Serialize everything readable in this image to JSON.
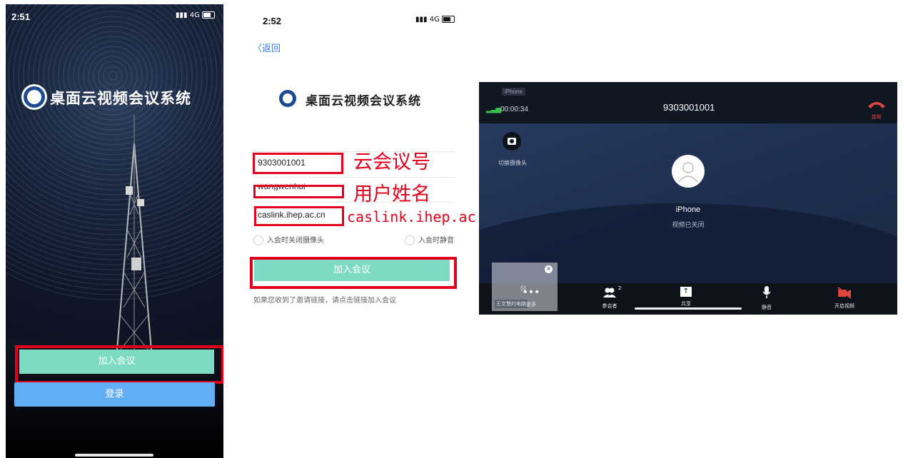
{
  "screen1": {
    "status": {
      "time": "2:51",
      "signal": "4G"
    },
    "app_title": "桌面云视频会议系统",
    "join_button": "加入会议",
    "login_button": "登录"
  },
  "screen2": {
    "status": {
      "time": "2:52",
      "signal": "4G"
    },
    "back": "〈返回",
    "app_title": "桌面云视频会议系统",
    "fields": {
      "meeting_id": "9303001001",
      "user_name": "wangwenhui",
      "server": "caslink.ihep.ac.cn"
    },
    "annotations": {
      "meeting_id": "云会议号",
      "user_name": "用户姓名",
      "server": "caslink.ihep.ac.cn"
    },
    "options": {
      "camera_off": "入会时关闭摄像头",
      "mute": "入会时静音"
    },
    "join_button": "加入会议",
    "hint": "如果您收到了邀请链接，请点击链接加入会议"
  },
  "screen3": {
    "device_label": "iPhone",
    "duration": "00:00:34",
    "meeting_id": "9303001001",
    "hangup": "挂断",
    "switch_camera": "切换摄像头",
    "participant_name": "iPhone",
    "video_status": "视频已关闭",
    "self_view_name": "王文慧的电脑",
    "participant_count": "2",
    "toolbar": [
      "更多",
      "参会者",
      "共享",
      "静音",
      "开启视频"
    ],
    "colors": {
      "hangup": "#e0463e",
      "signal": "#35c24a",
      "video_off": "#e0463e"
    }
  }
}
